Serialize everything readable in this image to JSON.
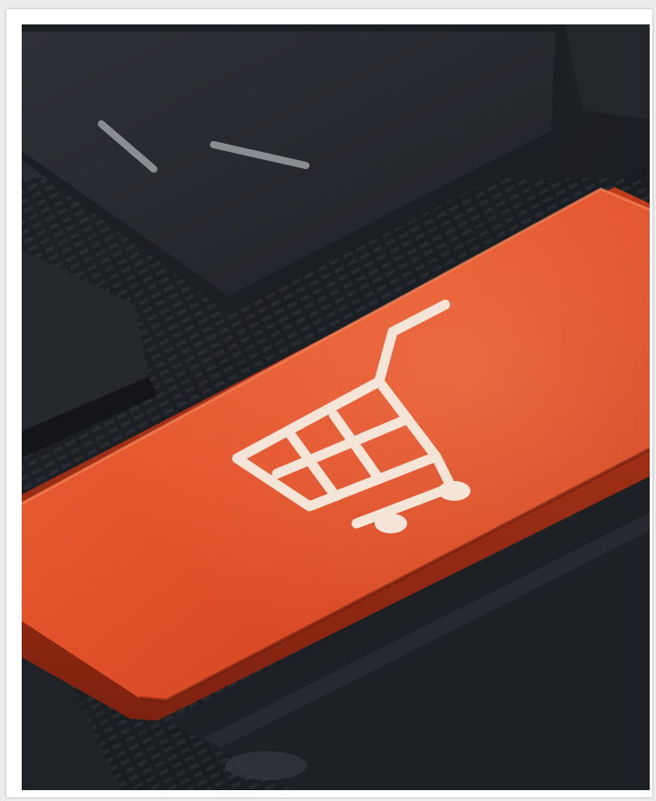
{
  "image": {
    "subject": "keyboard-with-orange-shopping-cart-key",
    "colors": {
      "key_orange": "#e2512b",
      "key_orange_light": "#f07a52",
      "key_orange_dark": "#8f2812",
      "keyboard_dark": "#1b1e23",
      "key_dark": "#25282e",
      "icon_fill": "#f6e6dc"
    },
    "icon": "shopping-cart-icon"
  }
}
